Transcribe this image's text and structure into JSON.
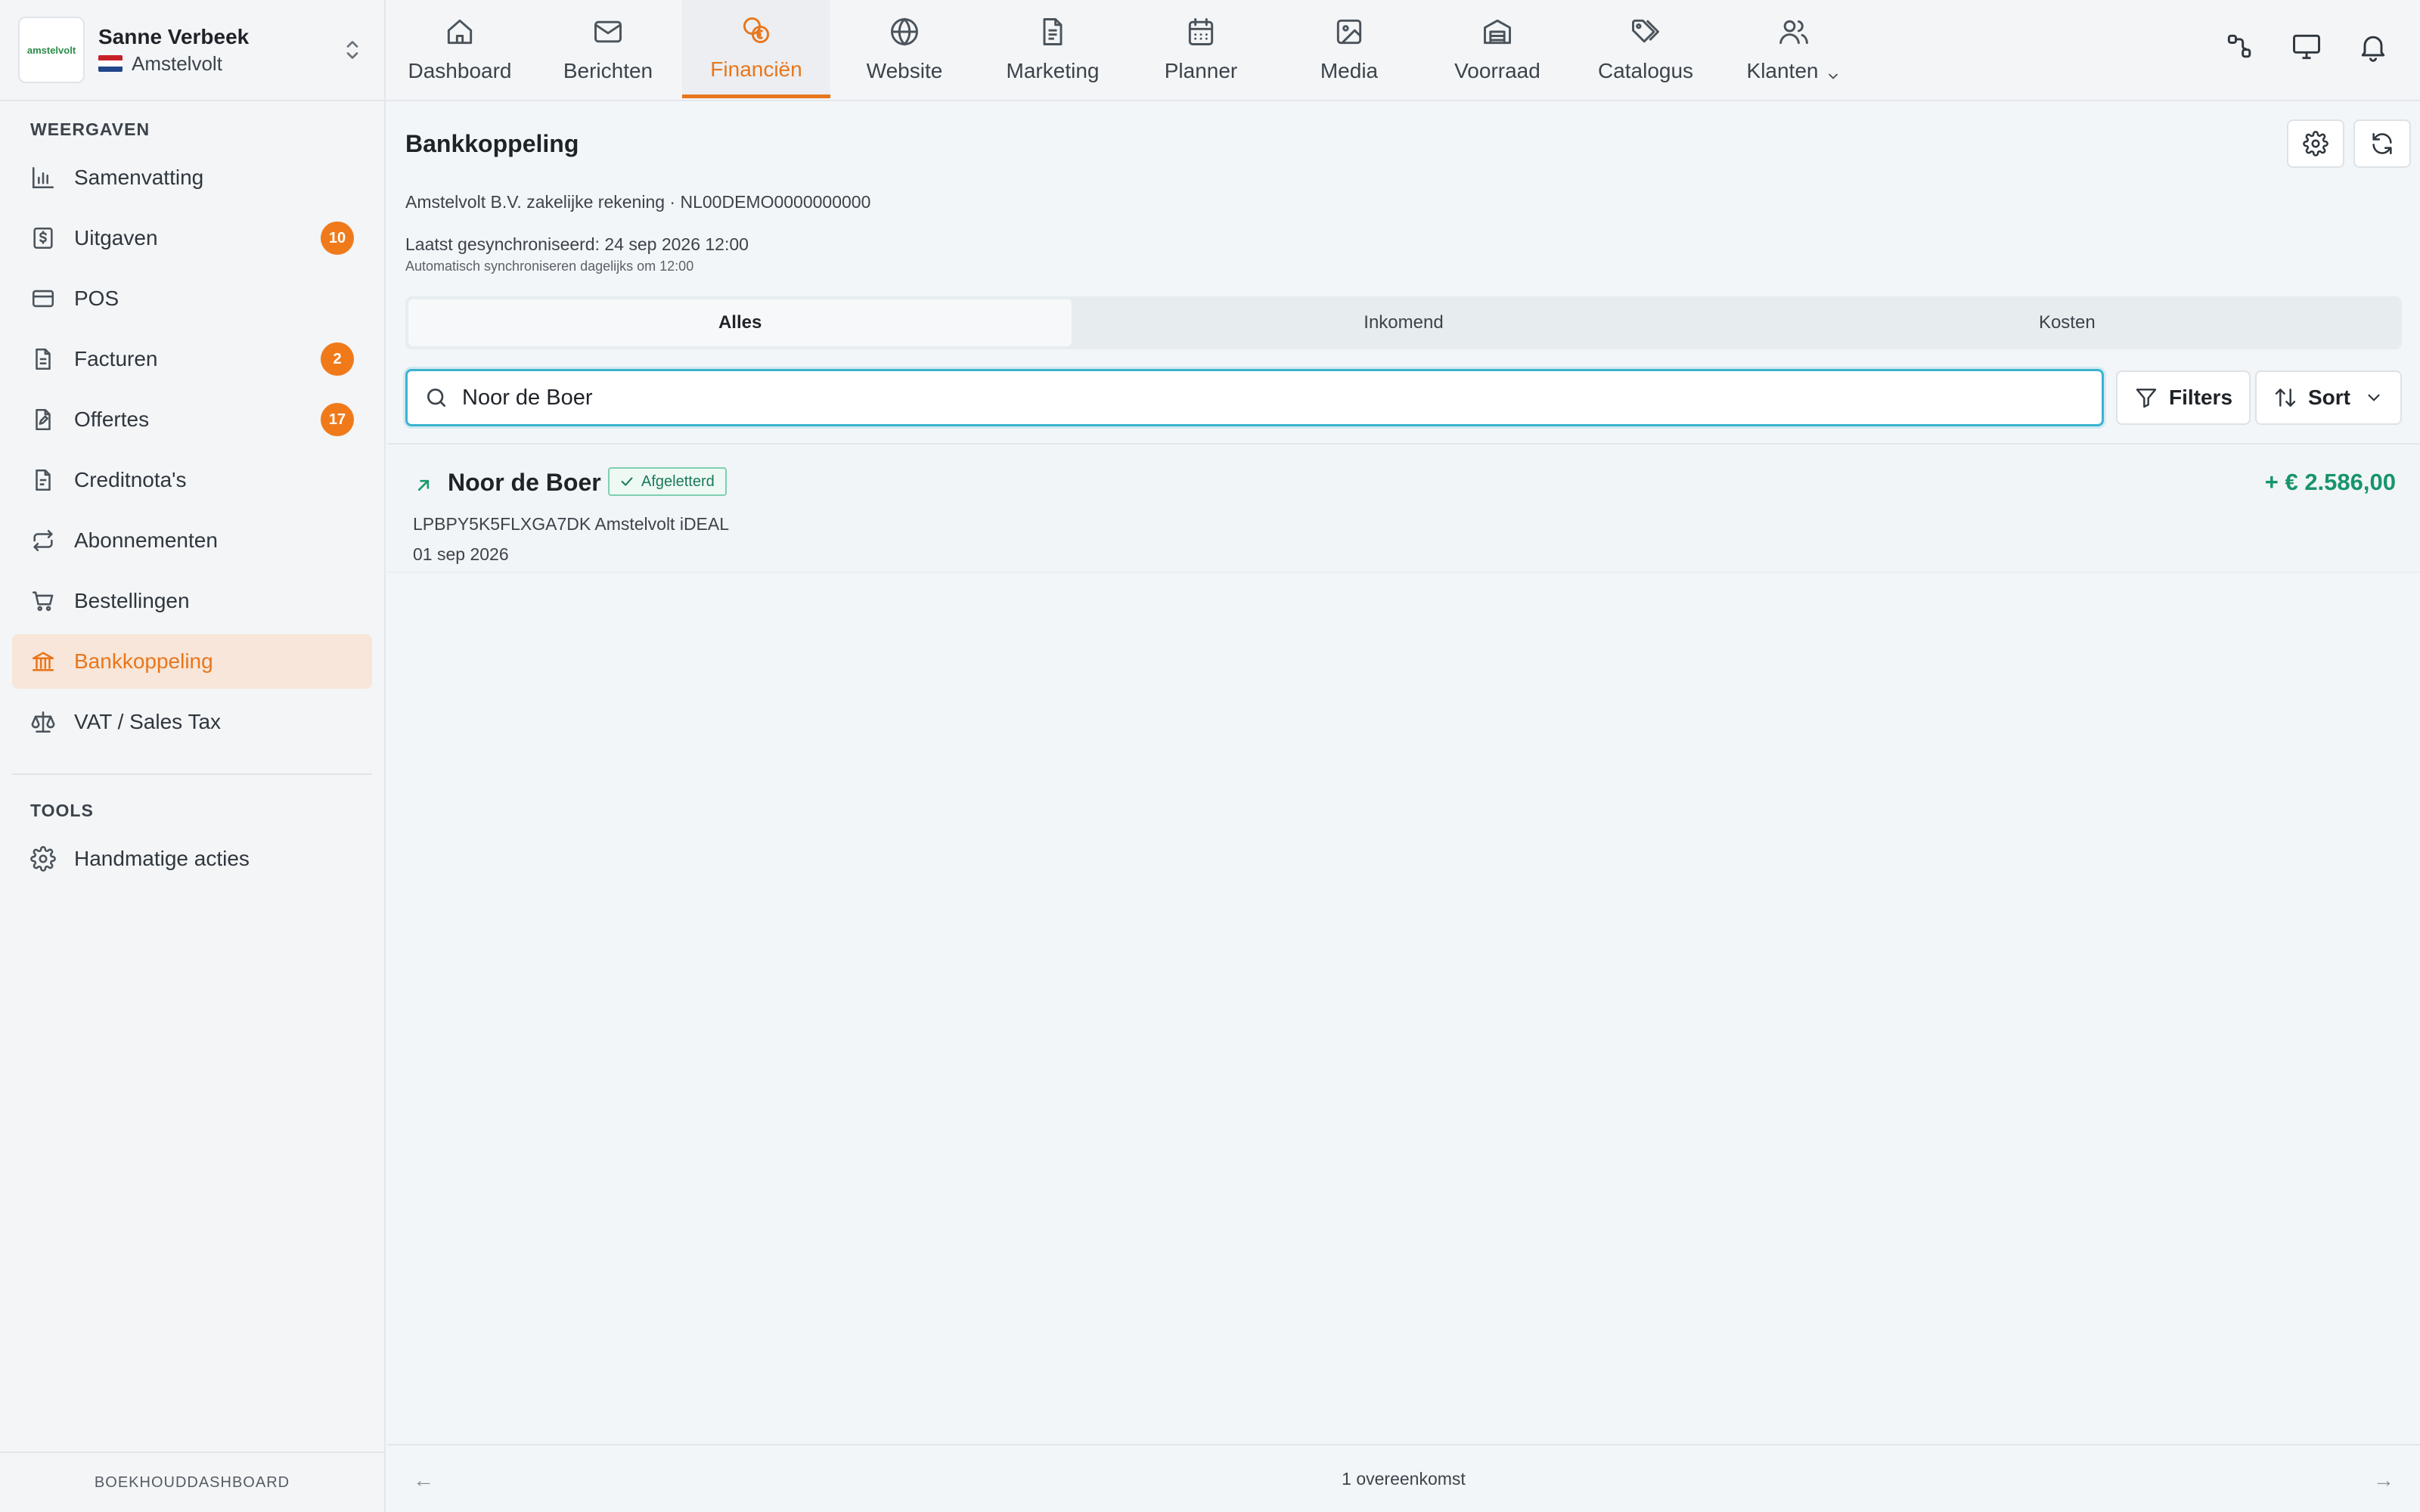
{
  "account": {
    "name": "Sanne Verbeek",
    "company": "Amstelvolt",
    "logo_text": "amstelvolt"
  },
  "sidebar": {
    "section_views": "WEERGAVEN",
    "items": [
      {
        "label": "Samenvatting",
        "icon": "bar-chart-icon"
      },
      {
        "label": "Uitgaven",
        "icon": "dollar-receipt-icon",
        "badge": "10"
      },
      {
        "label": "POS",
        "icon": "card-icon"
      },
      {
        "label": "Facturen",
        "icon": "document-icon",
        "badge": "2"
      },
      {
        "label": "Offertes",
        "icon": "document-edit-icon",
        "badge": "17"
      },
      {
        "label": "Creditnota's",
        "icon": "document-icon"
      },
      {
        "label": "Abonnementen",
        "icon": "repeat-icon"
      },
      {
        "label": "Bestellingen",
        "icon": "cart-icon"
      },
      {
        "label": "Bankkoppeling",
        "icon": "bank-icon",
        "active": true
      },
      {
        "label": "VAT / Sales Tax",
        "icon": "scale-icon"
      }
    ],
    "section_tools": "TOOLS",
    "tools": [
      {
        "label": "Handmatige acties",
        "icon": "gear-icon"
      }
    ],
    "footer": "BOEKHOUDDASHBOARD"
  },
  "topnav": {
    "tabs": [
      {
        "label": "Dashboard",
        "icon": "home-icon"
      },
      {
        "label": "Berichten",
        "icon": "mail-icon"
      },
      {
        "label": "Financiën",
        "icon": "coins-icon",
        "active": true
      },
      {
        "label": "Website",
        "icon": "globe-icon"
      },
      {
        "label": "Marketing",
        "icon": "document-icon"
      },
      {
        "label": "Planner",
        "icon": "calendar-icon"
      },
      {
        "label": "Media",
        "icon": "image-icon"
      },
      {
        "label": "Voorraad",
        "icon": "warehouse-icon"
      },
      {
        "label": "Catalogus",
        "icon": "tags-icon"
      },
      {
        "label": "Klanten",
        "icon": "users-icon",
        "dropdown": true
      }
    ],
    "right_icons": [
      "link-icon",
      "monitor-icon",
      "bell-icon"
    ]
  },
  "page": {
    "title": "Bankkoppeling",
    "account_line": "Amstelvolt B.V. zakelijke rekening · NL00DEMO0000000000",
    "last_sync": "Laatst gesynchroniseerd: 24 sep 2026 12:00",
    "auto_sync": "Automatisch synchroniseren dagelijks om 12:00",
    "segments": [
      {
        "label": "Alles",
        "active": true
      },
      {
        "label": "Inkomend"
      },
      {
        "label": "Kosten"
      }
    ],
    "search": {
      "value": "Noor de Boer",
      "placeholder": ""
    },
    "filters_label": "Filters",
    "sort_label": "Sort"
  },
  "transactions": [
    {
      "name": "Noor de Boer",
      "status": "Afgeletterd",
      "reference": "LPBPY5K5FLXGA7DK Amstelvolt iDEAL",
      "date": "01 sep 2026",
      "amount": "+ € 2.586,00",
      "direction": "incoming"
    }
  ],
  "pager": {
    "summary": "1 overeenkomst",
    "prev": "←",
    "next": "→"
  },
  "colors": {
    "accent": "#e8761c",
    "positive": "#17956a",
    "focus": "#3bb3cf",
    "badge": "#f07a1a"
  }
}
